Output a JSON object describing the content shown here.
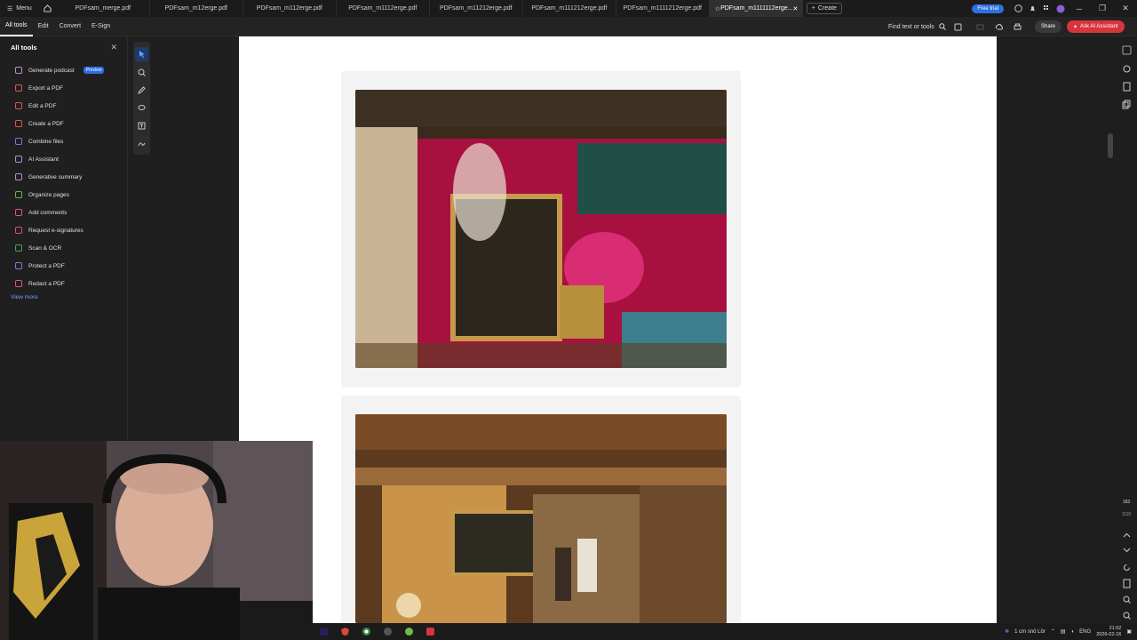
{
  "tabbar": {
    "menu_label": "Menu",
    "tabs": [
      {
        "label": "PDFsam_merge.pdf"
      },
      {
        "label": "PDFsam_m12erge.pdf"
      },
      {
        "label": "PDFsam_m112erge.pdf"
      },
      {
        "label": "PDFsam_m1112erge.pdf"
      },
      {
        "label": "PDFsam_m11212erge.pdf"
      },
      {
        "label": "PDFsam_m111212erge.pdf"
      },
      {
        "label": "PDFsam_m1111212erge.pdf"
      },
      {
        "label": "PDFsam_m1111112erge..."
      }
    ],
    "create_label": "Create",
    "free_trial_label": "Free trial"
  },
  "toolbar": {
    "tabs": [
      "All tools",
      "Edit",
      "Convert",
      "E-Sign"
    ],
    "find_label": "Find text or tools",
    "share_label": "Share",
    "ask_ai_label": "Ask AI Assistant"
  },
  "sidebar": {
    "title": "All tools",
    "items": [
      {
        "label": "Generate podcast",
        "icon": "podcast-icon",
        "color": "#b88bd8"
      },
      {
        "label": "Export a PDF",
        "icon": "export-pdf-icon",
        "color": "#e0524f"
      },
      {
        "label": "Edit a PDF",
        "icon": "edit-pdf-icon",
        "color": "#e0524f"
      },
      {
        "label": "Create a PDF",
        "icon": "create-pdf-icon",
        "color": "#e0524f"
      },
      {
        "label": "Combine files",
        "icon": "combine-files-icon",
        "color": "#8b6fd6"
      },
      {
        "label": "AI Assistant",
        "icon": "ai-assistant-icon",
        "color": "#b88bd8"
      },
      {
        "label": "Generative summary",
        "icon": "summary-icon",
        "color": "#b88bd8"
      },
      {
        "label": "Organize pages",
        "icon": "organize-pages-icon",
        "color": "#5fb548"
      },
      {
        "label": "Add comments",
        "icon": "comment-icon",
        "color": "#e04f8d"
      },
      {
        "label": "Request e-signatures",
        "icon": "signature-icon",
        "color": "#d84a8f"
      },
      {
        "label": "Scan & OCR",
        "icon": "scan-icon",
        "color": "#3fa54e"
      },
      {
        "label": "Protect a PDF",
        "icon": "protect-icon",
        "color": "#8b6fd6"
      },
      {
        "label": "Redact a PDF",
        "icon": "redact-icon",
        "color": "#e04f8d"
      }
    ],
    "preview_badge": "Preview",
    "view_more_label": "View more"
  },
  "viewer": {
    "page_count": "183",
    "page_total": "1110"
  },
  "taskbar": {
    "weather": "1 cm snö Lör",
    "lang": "ENG",
    "time": "21:02",
    "date": "2026-02-16"
  }
}
